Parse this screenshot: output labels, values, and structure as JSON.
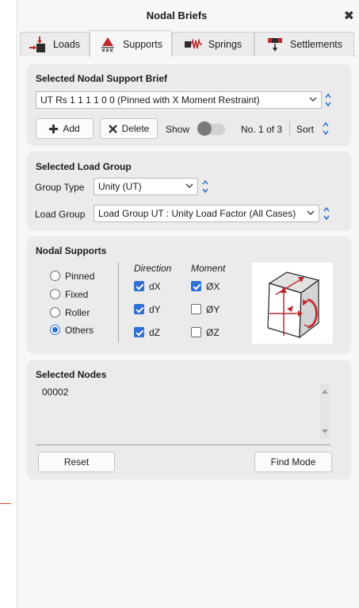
{
  "panel": {
    "title": "Nodal Briefs",
    "close_icon": "close-icon"
  },
  "tabs": [
    {
      "label": "Loads",
      "icon": "loads-icon"
    },
    {
      "label": "Supports",
      "icon": "supports-icon",
      "active": true
    },
    {
      "label": "Springs",
      "icon": "springs-icon"
    },
    {
      "label": "Settlements",
      "icon": "settlements-icon"
    }
  ],
  "brief": {
    "title": "Selected Nodal Support Brief",
    "selected": "UT Rs 1 1 1 1 0 0 (Pinned with X Moment Restraint)",
    "add_label": "Add",
    "delete_label": "Delete",
    "show_label": "Show",
    "counter": "No. 1 of 3",
    "sort_label": "Sort"
  },
  "load_group": {
    "title": "Selected Load Group",
    "type_label": "Group Type",
    "type_value": "Unity (UT)",
    "group_label": "Load Group",
    "group_value": "Load Group UT : Unity Load Factor (All Cases)"
  },
  "supports": {
    "title": "Nodal Supports",
    "options": [
      "Pinned",
      "Fixed",
      "Roller",
      "Others"
    ],
    "selected": "Others",
    "direction_header": "Direction",
    "moment_header": "Moment",
    "direction": [
      {
        "label": "dX",
        "checked": true
      },
      {
        "label": "dY",
        "checked": true
      },
      {
        "label": "dZ",
        "checked": true
      }
    ],
    "moment": [
      {
        "label": "ØX",
        "checked": true
      },
      {
        "label": "ØY",
        "checked": false
      },
      {
        "label": "ØZ",
        "checked": false
      }
    ]
  },
  "nodes": {
    "title": "Selected Nodes",
    "items": [
      "00002"
    ],
    "reset_label": "Reset",
    "find_label": "Find Mode"
  },
  "colors": {
    "accent": "#2f6fd6",
    "icon_red": "#c0282d",
    "card_bg": "#ebebeb",
    "panel_bg": "#f7f7f7"
  }
}
